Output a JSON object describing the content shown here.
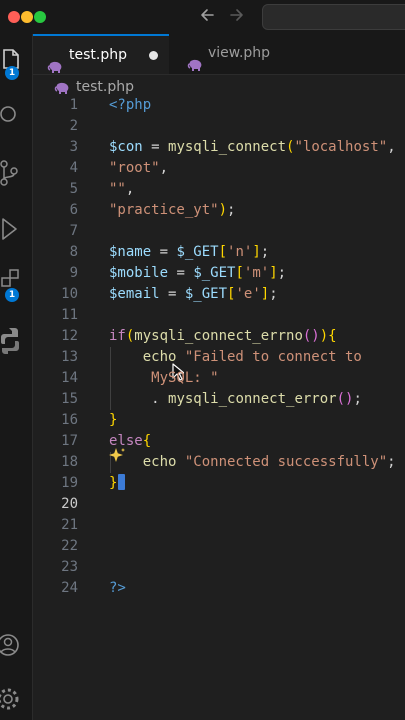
{
  "window": {
    "back_icon": "arrow-left-icon",
    "forward_icon": "arrow-right-icon"
  },
  "activity_bar": {
    "items": [
      {
        "name": "explorer",
        "icon": "files-icon",
        "badge": "1"
      },
      {
        "name": "search",
        "icon": "search-icon"
      },
      {
        "name": "source-control",
        "icon": "source-control-icon"
      },
      {
        "name": "run-debug",
        "icon": "run-debug-icon"
      },
      {
        "name": "extensions",
        "icon": "extensions-icon",
        "badge": "1"
      },
      {
        "name": "python",
        "icon": "python-icon"
      },
      {
        "name": "accounts",
        "icon": "account-icon"
      },
      {
        "name": "manage",
        "icon": "gear-icon"
      }
    ],
    "badge_color": "#0078d4"
  },
  "tabs": [
    {
      "label": "test.php",
      "active": true,
      "dirty": true,
      "icon": "php-elephant-icon"
    },
    {
      "label": "view.php",
      "active": false,
      "dirty": false,
      "icon": "php-elephant-icon"
    }
  ],
  "breadcrumb": {
    "label": "test.php",
    "icon": "php-elephant-icon"
  },
  "editor": {
    "current_line": 20,
    "lines": [
      {
        "n": "1",
        "tokens": [
          {
            "t": "<?php",
            "c": "#569cd6"
          }
        ]
      },
      {
        "n": "2",
        "tokens": []
      },
      {
        "n": "3",
        "tokens": [
          {
            "t": "$con",
            "c": "#9cdcfe"
          },
          {
            "t": " = ",
            "c": "#d4d4d4"
          },
          {
            "t": "mysqli_connect",
            "c": "#dcdcaa"
          },
          {
            "t": "(",
            "c": "#ffd700"
          },
          {
            "t": "\"localhost\"",
            "c": "#ce9178"
          },
          {
            "t": ",",
            "c": "#d4d4d4"
          }
        ]
      },
      {
        "n": "4",
        "tokens": [
          {
            "t": "\"root\"",
            "c": "#ce9178"
          },
          {
            "t": ",",
            "c": "#d4d4d4"
          }
        ]
      },
      {
        "n": "5",
        "tokens": [
          {
            "t": "\"\"",
            "c": "#ce9178"
          },
          {
            "t": ",",
            "c": "#d4d4d4"
          }
        ]
      },
      {
        "n": "6",
        "tokens": [
          {
            "t": "\"practice_yt\"",
            "c": "#ce9178"
          },
          {
            "t": ")",
            "c": "#ffd700"
          },
          {
            "t": ";",
            "c": "#d4d4d4"
          }
        ]
      },
      {
        "n": "7",
        "tokens": []
      },
      {
        "n": "8",
        "tokens": [
          {
            "t": "$name",
            "c": "#9cdcfe"
          },
          {
            "t": " = ",
            "c": "#d4d4d4"
          },
          {
            "t": "$_GET",
            "c": "#9cdcfe"
          },
          {
            "t": "[",
            "c": "#ffd700"
          },
          {
            "t": "'n'",
            "c": "#ce9178"
          },
          {
            "t": "]",
            "c": "#ffd700"
          },
          {
            "t": ";",
            "c": "#d4d4d4"
          }
        ]
      },
      {
        "n": "9",
        "tokens": [
          {
            "t": "$mobile",
            "c": "#9cdcfe"
          },
          {
            "t": " = ",
            "c": "#d4d4d4"
          },
          {
            "t": "$_GET",
            "c": "#9cdcfe"
          },
          {
            "t": "[",
            "c": "#ffd700"
          },
          {
            "t": "'m'",
            "c": "#ce9178"
          },
          {
            "t": "]",
            "c": "#ffd700"
          },
          {
            "t": ";",
            "c": "#d4d4d4"
          }
        ]
      },
      {
        "n": "10",
        "tokens": [
          {
            "t": "$email",
            "c": "#9cdcfe"
          },
          {
            "t": " = ",
            "c": "#d4d4d4"
          },
          {
            "t": "$_GET",
            "c": "#9cdcfe"
          },
          {
            "t": "[",
            "c": "#ffd700"
          },
          {
            "t": "'e'",
            "c": "#ce9178"
          },
          {
            "t": "]",
            "c": "#ffd700"
          },
          {
            "t": ";",
            "c": "#d4d4d4"
          }
        ]
      },
      {
        "n": "11",
        "tokens": []
      },
      {
        "n": "12",
        "tokens": [
          {
            "t": "if",
            "c": "#c586c0"
          },
          {
            "t": "(",
            "c": "#ffd700"
          },
          {
            "t": "mysqli_connect_errno",
            "c": "#dcdcaa"
          },
          {
            "t": "()",
            "c": "#da70d6"
          },
          {
            "t": ")",
            "c": "#ffd700"
          },
          {
            "t": "{",
            "c": "#ffd700"
          }
        ]
      },
      {
        "n": "13",
        "tokens": [
          {
            "t": "    echo ",
            "c": "#dcdcaa"
          },
          {
            "t": "\"Failed to connect to",
            "c": "#ce9178"
          }
        ]
      },
      {
        "n": "14",
        "tokens": [
          {
            "t": "     MySQL: \"",
            "c": "#ce9178"
          }
        ]
      },
      {
        "n": "15",
        "tokens": [
          {
            "t": "     . ",
            "c": "#d4d4d4"
          },
          {
            "t": "mysqli_connect_error",
            "c": "#dcdcaa"
          },
          {
            "t": "()",
            "c": "#da70d6"
          },
          {
            "t": ";",
            "c": "#d4d4d4"
          }
        ]
      },
      {
        "n": "16",
        "tokens": [
          {
            "t": "}",
            "c": "#ffd700"
          }
        ]
      },
      {
        "n": "17",
        "tokens": [
          {
            "t": "else",
            "c": "#c586c0"
          },
          {
            "t": "{",
            "c": "#ffd700"
          }
        ]
      },
      {
        "n": "18",
        "tokens": [
          {
            "t": "    echo ",
            "c": "#dcdcaa"
          },
          {
            "t": "\"Connected successfully\"",
            "c": "#ce9178"
          },
          {
            "t": ";",
            "c": "#d4d4d4"
          }
        ]
      },
      {
        "n": "19",
        "tokens": [
          {
            "t": "}",
            "c": "#ffd700"
          }
        ],
        "cursor": true
      },
      {
        "n": "20",
        "tokens": []
      },
      {
        "n": "21",
        "tokens": []
      },
      {
        "n": "22",
        "tokens": []
      },
      {
        "n": "23",
        "tokens": []
      },
      {
        "n": "24",
        "tokens": [
          {
            "t": "?>",
            "c": "#569cd6"
          }
        ]
      }
    ]
  },
  "colors": {
    "accent": "#0078d4",
    "editor_bg": "#1f1f1f",
    "chrome_bg": "#181818"
  }
}
